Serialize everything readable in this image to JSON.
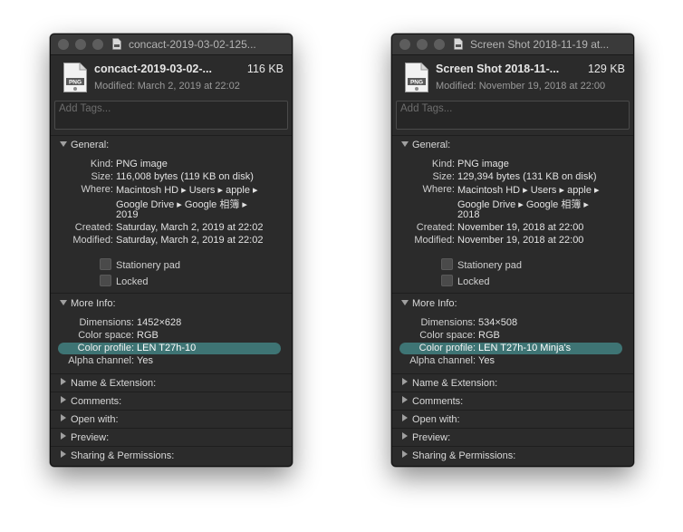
{
  "windows": [
    {
      "title": "concact-2019-03-02-125...",
      "file_name": "concact-2019-03-02-...",
      "file_size": "116 KB",
      "modified_line": "Modified: March 2, 2019 at 22:02",
      "tags_placeholder": "Add Tags...",
      "general": {
        "heading": "General:",
        "rows": [
          {
            "label": "Kind:",
            "value": "PNG image"
          },
          {
            "label": "Size:",
            "value": "116,008 bytes (119 KB on disk)"
          },
          {
            "label": "Where:",
            "value": "Macintosh HD ▸ Users ▸ apple ▸"
          },
          {
            "label": "",
            "value": "Google Drive ▸ Google 相簿 ▸"
          },
          {
            "label": "",
            "value": "2019"
          },
          {
            "label": "Created:",
            "value": "Saturday, March 2, 2019 at 22:02"
          },
          {
            "label": "Modified:",
            "value": "Saturday, March 2, 2019 at 22:02"
          }
        ],
        "stationery": "Stationery pad",
        "locked": "Locked"
      },
      "more_info": {
        "heading": "More Info:",
        "rows": [
          {
            "label": "Dimensions:",
            "value": "1452×628"
          },
          {
            "label": "Color space:",
            "value": "RGB"
          },
          {
            "label": "Color profile:",
            "value": "LEN T27h-10"
          },
          {
            "label": "Alpha channel:",
            "value": "Yes"
          }
        ]
      },
      "sections": [
        "Name & Extension:",
        "Comments:",
        "Open with:",
        "Preview:",
        "Sharing & Permissions:"
      ]
    },
    {
      "title": "Screen Shot 2018-11-19 at...",
      "file_name": "Screen Shot 2018-11-...",
      "file_size": "129 KB",
      "modified_line": "Modified: November 19, 2018 at 22:00",
      "tags_placeholder": "Add Tags...",
      "general": {
        "heading": "General:",
        "rows": [
          {
            "label": "Kind:",
            "value": "PNG image"
          },
          {
            "label": "Size:",
            "value": "129,394 bytes (131 KB on disk)"
          },
          {
            "label": "Where:",
            "value": "Macintosh HD ▸ Users ▸ apple ▸"
          },
          {
            "label": "",
            "value": "Google Drive ▸ Google 相簿 ▸"
          },
          {
            "label": "",
            "value": "2018"
          },
          {
            "label": "Created:",
            "value": "November 19, 2018 at 22:00"
          },
          {
            "label": "Modified:",
            "value": "November 19, 2018 at 22:00"
          }
        ],
        "stationery": "Stationery pad",
        "locked": "Locked"
      },
      "more_info": {
        "heading": "More Info:",
        "rows": [
          {
            "label": "Dimensions:",
            "value": "534×508"
          },
          {
            "label": "Color space:",
            "value": "RGB"
          },
          {
            "label": "Color profile:",
            "value": "LEN T27h-10 Minja's"
          },
          {
            "label": "Alpha channel:",
            "value": "Yes"
          }
        ]
      },
      "sections": [
        "Name & Extension:",
        "Comments:",
        "Open with:",
        "Preview:",
        "Sharing & Permissions:"
      ]
    }
  ],
  "icon_names": [
    "window-close-icon",
    "window-minimize-icon",
    "window-zoom-icon",
    "png-file-icon",
    "disclosure-triangle-icon",
    "checkbox-icon"
  ],
  "colors": {
    "window_bg": "#2b2b2b",
    "highlight": "#3e7474",
    "text": "#dcdcdc"
  },
  "file_badge": "PNG"
}
